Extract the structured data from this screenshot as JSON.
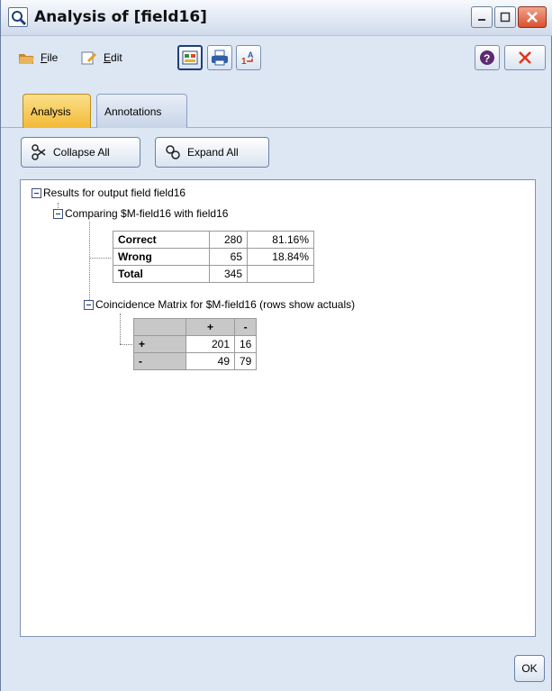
{
  "window": {
    "title": "Analysis of [field16]",
    "icons": [
      "magnifier-icon",
      "minimize-icon",
      "maximize-icon",
      "close-icon"
    ]
  },
  "toolbar": {
    "file_label": "File",
    "file_mnemonic": "F",
    "file_rest": "ile",
    "edit_label": "Edit",
    "edit_mnemonic": "E",
    "edit_rest": "dit",
    "icons": [
      "file-icon",
      "edit-icon",
      "report-icon",
      "print-icon",
      "row-number-icon",
      "help-icon",
      "close-x-icon"
    ]
  },
  "tabs": [
    {
      "label": "Analysis",
      "active": true
    },
    {
      "label": "Annotations",
      "active": false
    }
  ],
  "actions": {
    "collapse_label": "Collapse All",
    "expand_label": "Expand All"
  },
  "tree": {
    "root": "Results for output field field16",
    "comparing": "Comparing $M-field16 with field16",
    "summary_rows": [
      {
        "label": "Correct",
        "count": "280",
        "percent": "81.16%"
      },
      {
        "label": "Wrong",
        "count": "65",
        "percent": "18.84%"
      },
      {
        "label": "Total",
        "count": "345",
        "percent": ""
      }
    ],
    "coincidence": "Coincidence Matrix for $M-field16 (rows show actuals)",
    "matrix": {
      "headers": [
        "",
        "+",
        "-"
      ],
      "rows": [
        {
          "label": "+",
          "values": [
            "201",
            "16"
          ]
        },
        {
          "label": "-",
          "values": [
            "49",
            "79"
          ]
        }
      ]
    }
  },
  "ok_label": "OK",
  "colors": {
    "active_tab": "#f2b935",
    "chrome": "#dde6f3",
    "matrix_header": "#c8c8c8"
  }
}
